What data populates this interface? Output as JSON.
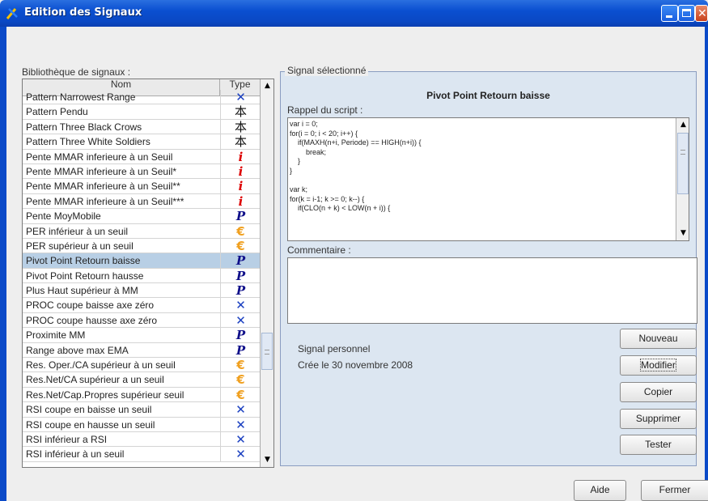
{
  "window": {
    "title": "Edition des Signaux"
  },
  "library": {
    "label": "Bibliothèque de signaux :",
    "col_name": "Nom",
    "col_type": "Type",
    "rows": [
      {
        "name": "Pattern Narrowest Range",
        "type": "cross"
      },
      {
        "name": "Pattern Pendu",
        "type": "kanji"
      },
      {
        "name": "Pattern Three Black Crows",
        "type": "kanji"
      },
      {
        "name": "Pattern Three White Soldiers",
        "type": "kanji"
      },
      {
        "name": "Pente MMAR inferieure à un Seuil",
        "type": "i"
      },
      {
        "name": "Pente MMAR inferieure à un Seuil*",
        "type": "i"
      },
      {
        "name": "Pente MMAR inferieure à un Seuil**",
        "type": "i"
      },
      {
        "name": "Pente MMAR inferieure à un Seuil***",
        "type": "i"
      },
      {
        "name": "Pente MoyMobile",
        "type": "p"
      },
      {
        "name": "PER inférieur à un seuil",
        "type": "euro"
      },
      {
        "name": "PER supérieur à un seuil",
        "type": "euro"
      },
      {
        "name": "Pivot Point Retourn baisse",
        "type": "p"
      },
      {
        "name": "Pivot Point Retourn hausse",
        "type": "p"
      },
      {
        "name": "Plus Haut supérieur à MM",
        "type": "p"
      },
      {
        "name": "PROC coupe baisse axe zéro",
        "type": "cross"
      },
      {
        "name": "PROC coupe hausse axe zéro",
        "type": "cross"
      },
      {
        "name": "Proximite MM",
        "type": "p"
      },
      {
        "name": "Range above max EMA",
        "type": "p"
      },
      {
        "name": "Res. Oper./CA supérieur à un seuil",
        "type": "euro"
      },
      {
        "name": "Res.Net/CA supérieur a un seuil",
        "type": "euro"
      },
      {
        "name": "Res.Net/Cap.Propres supérieur seuil",
        "type": "euro"
      },
      {
        "name": "RSI coupe en baisse un seuil",
        "type": "cross"
      },
      {
        "name": "RSI coupe en hausse un seuil",
        "type": "cross"
      },
      {
        "name": "RSI inférieur a RSI",
        "type": "cross"
      },
      {
        "name": "RSI inférieur à un seuil",
        "type": "cross"
      }
    ],
    "selected_index": 11
  },
  "type_glyphs": {
    "p": "P",
    "i": "i",
    "euro": "€",
    "cross": "✕",
    "kanji": "本"
  },
  "signal": {
    "group_label": "Signal sélectionné",
    "title": "Pivot Point Retourn baisse",
    "script_label": "Rappel du script :",
    "script_lines": [
      "var i = 0;",
      "for(i = 0; i < 20; i++) {",
      "    if(MAXH(n+i, Periode) == HIGH(n+i)) {",
      "        break;",
      "    }",
      "}",
      "",
      "var k;",
      "for(k = i-1; k >= 0; k--) {",
      "    if(CLO(n + k) < LOW(n + i)) {"
    ],
    "comment_label": "Commentaire :",
    "comment": "",
    "info_type": "Signal personnel",
    "info_date": "Crée le 30 novembre 2008"
  },
  "buttons": {
    "new": "Nouveau",
    "edit": "Modifier",
    "copy": "Copier",
    "delete": "Supprimer",
    "test": "Tester",
    "help": "Aide",
    "close": "Fermer"
  }
}
